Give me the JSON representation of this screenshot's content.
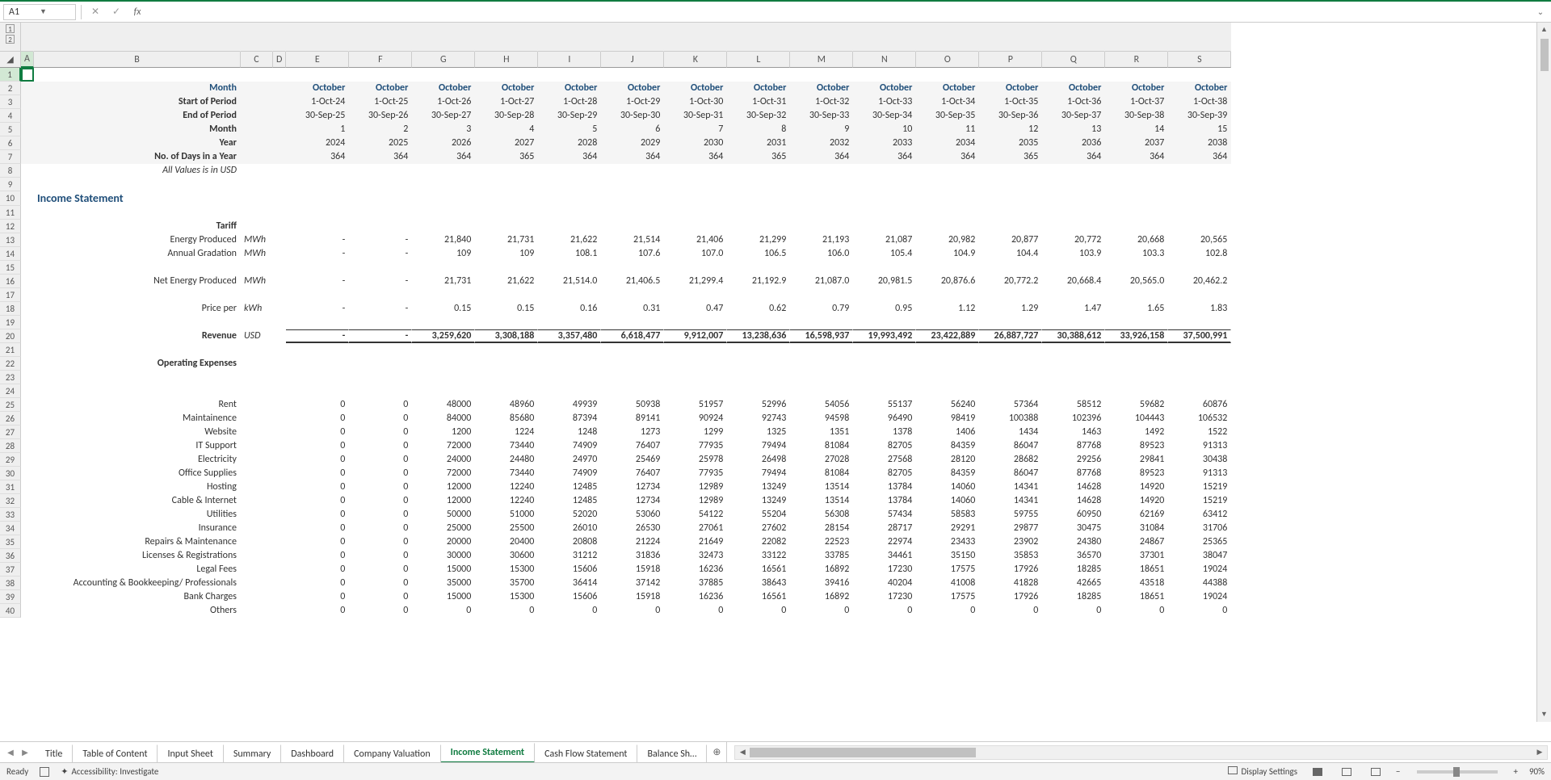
{
  "nameBox": "A1",
  "formula": "",
  "outlineLevels": [
    "1",
    "2"
  ],
  "colHeaders": [
    "",
    "A",
    "B",
    "C",
    "D",
    "E",
    "F",
    "G",
    "H",
    "I",
    "J",
    "K",
    "L",
    "M",
    "N",
    "O",
    "P",
    "Q",
    "R",
    "S"
  ],
  "rowHeaders": [
    "1",
    "2",
    "3",
    "4",
    "5",
    "6",
    "7",
    "8",
    "9",
    "10",
    "11",
    "12",
    "13",
    "14",
    "15",
    "16",
    "17",
    "18",
    "19",
    "20",
    "21",
    "22",
    "23",
    "24",
    "25",
    "26",
    "27",
    "28",
    "29",
    "30",
    "31",
    "32",
    "33",
    "34",
    "35",
    "36",
    "37",
    "38",
    "39",
    "40"
  ],
  "headerBlock": {
    "monthLabel": "Month",
    "startLabel": "Start of Period",
    "endLabel": "End of Period",
    "monthLabel2": "Month",
    "yearLabel": "Year",
    "daysLabel": "No. of Days in a Year",
    "noteLabel": "All Values is in USD",
    "monthRow": [
      "October",
      "October",
      "October",
      "October",
      "October",
      "October",
      "October",
      "October",
      "October",
      "October",
      "October",
      "October",
      "October",
      "October",
      "October"
    ],
    "startRow": [
      "1-Oct-24",
      "1-Oct-25",
      "1-Oct-26",
      "1-Oct-27",
      "1-Oct-28",
      "1-Oct-29",
      "1-Oct-30",
      "1-Oct-31",
      "1-Oct-32",
      "1-Oct-33",
      "1-Oct-34",
      "1-Oct-35",
      "1-Oct-36",
      "1-Oct-37",
      "1-Oct-38"
    ],
    "endRow": [
      "30-Sep-25",
      "30-Sep-26",
      "30-Sep-27",
      "30-Sep-28",
      "30-Sep-29",
      "30-Sep-30",
      "30-Sep-31",
      "30-Sep-32",
      "30-Sep-33",
      "30-Sep-34",
      "30-Sep-35",
      "30-Sep-36",
      "30-Sep-37",
      "30-Sep-38",
      "30-Sep-39"
    ],
    "monthNumRow": [
      "1",
      "2",
      "3",
      "4",
      "5",
      "6",
      "7",
      "8",
      "9",
      "10",
      "11",
      "12",
      "13",
      "14",
      "15"
    ],
    "yearRow": [
      "2024",
      "2025",
      "2026",
      "2027",
      "2028",
      "2029",
      "2030",
      "2031",
      "2032",
      "2033",
      "2034",
      "2035",
      "2036",
      "2037",
      "2038"
    ],
    "daysRow": [
      "364",
      "364",
      "364",
      "365",
      "364",
      "364",
      "364",
      "365",
      "364",
      "364",
      "364",
      "365",
      "364",
      "364",
      "364"
    ]
  },
  "sectionIncome": "Income Statement",
  "sectionTariff": "Tariff",
  "tariff": {
    "energyProducedLabel": "Energy Produced",
    "energyProducedUnit": "MWh",
    "energyProduced": [
      "-",
      "-",
      "21,840",
      "21,731",
      "21,622",
      "21,514",
      "21,406",
      "21,299",
      "21,193",
      "21,087",
      "20,982",
      "20,877",
      "20,772",
      "20,668",
      "20,565"
    ],
    "gradationLabel": "Annual Gradation",
    "gradationUnit": "MWh",
    "gradation": [
      "-",
      "-",
      "109",
      "109",
      "108.1",
      "107.6",
      "107.0",
      "106.5",
      "106.0",
      "105.4",
      "104.9",
      "104.4",
      "103.9",
      "103.3",
      "102.8"
    ],
    "netEnergyLabel": "Net Energy Produced",
    "netEnergyUnit": "MWh",
    "netEnergy": [
      "-",
      "-",
      "21,731",
      "21,622",
      "21,514.0",
      "21,406.5",
      "21,299.4",
      "21,192.9",
      "21,087.0",
      "20,981.5",
      "20,876.6",
      "20,772.2",
      "20,668.4",
      "20,565.0",
      "20,462.2"
    ],
    "priceLabel": "Price per",
    "priceUnit": "kWh",
    "price": [
      "-",
      "-",
      "0.15",
      "0.15",
      "0.16",
      "0.31",
      "0.47",
      "0.62",
      "0.79",
      "0.95",
      "1.12",
      "1.29",
      "1.47",
      "1.65",
      "1.83"
    ]
  },
  "revenueLabel": "Revenue",
  "revenueUnit": "USD",
  "revenue": [
    "-",
    "-",
    "3,259,620",
    "3,308,188",
    "3,357,480",
    "6,618,477",
    "9,912,007",
    "13,238,636",
    "16,598,937",
    "19,993,492",
    "23,422,889",
    "26,887,727",
    "30,388,612",
    "33,926,158",
    "37,500,991"
  ],
  "sectionOpex": "Operating Expenses",
  "opexRows": [
    {
      "label": "Rent",
      "v": [
        "0",
        "0",
        "48000",
        "48960",
        "49939",
        "50938",
        "51957",
        "52996",
        "54056",
        "55137",
        "56240",
        "57364",
        "58512",
        "59682",
        "60876"
      ]
    },
    {
      "label": "Maintainence",
      "v": [
        "0",
        "0",
        "84000",
        "85680",
        "87394",
        "89141",
        "90924",
        "92743",
        "94598",
        "96490",
        "98419",
        "100388",
        "102396",
        "104443",
        "106532"
      ]
    },
    {
      "label": "Website",
      "v": [
        "0",
        "0",
        "1200",
        "1224",
        "1248",
        "1273",
        "1299",
        "1325",
        "1351",
        "1378",
        "1406",
        "1434",
        "1463",
        "1492",
        "1522"
      ]
    },
    {
      "label": "IT Support",
      "v": [
        "0",
        "0",
        "72000",
        "73440",
        "74909",
        "76407",
        "77935",
        "79494",
        "81084",
        "82705",
        "84359",
        "86047",
        "87768",
        "89523",
        "91313"
      ]
    },
    {
      "label": "Electricity",
      "v": [
        "0",
        "0",
        "24000",
        "24480",
        "24970",
        "25469",
        "25978",
        "26498",
        "27028",
        "27568",
        "28120",
        "28682",
        "29256",
        "29841",
        "30438"
      ]
    },
    {
      "label": "Office Supplies",
      "v": [
        "0",
        "0",
        "72000",
        "73440",
        "74909",
        "76407",
        "77935",
        "79494",
        "81084",
        "82705",
        "84359",
        "86047",
        "87768",
        "89523",
        "91313"
      ]
    },
    {
      "label": "Hosting",
      "v": [
        "0",
        "0",
        "12000",
        "12240",
        "12485",
        "12734",
        "12989",
        "13249",
        "13514",
        "13784",
        "14060",
        "14341",
        "14628",
        "14920",
        "15219"
      ]
    },
    {
      "label": "Cable & Internet",
      "v": [
        "0",
        "0",
        "12000",
        "12240",
        "12485",
        "12734",
        "12989",
        "13249",
        "13514",
        "13784",
        "14060",
        "14341",
        "14628",
        "14920",
        "15219"
      ]
    },
    {
      "label": "Utilities",
      "v": [
        "0",
        "0",
        "50000",
        "51000",
        "52020",
        "53060",
        "54122",
        "55204",
        "56308",
        "57434",
        "58583",
        "59755",
        "60950",
        "62169",
        "63412"
      ]
    },
    {
      "label": "Insurance",
      "v": [
        "0",
        "0",
        "25000",
        "25500",
        "26010",
        "26530",
        "27061",
        "27602",
        "28154",
        "28717",
        "29291",
        "29877",
        "30475",
        "31084",
        "31706"
      ]
    },
    {
      "label": "Repairs & Maintenance",
      "v": [
        "0",
        "0",
        "20000",
        "20400",
        "20808",
        "21224",
        "21649",
        "22082",
        "22523",
        "22974",
        "23433",
        "23902",
        "24380",
        "24867",
        "25365"
      ]
    },
    {
      "label": "Licenses & Registrations",
      "v": [
        "0",
        "0",
        "30000",
        "30600",
        "31212",
        "31836",
        "32473",
        "33122",
        "33785",
        "34461",
        "35150",
        "35853",
        "36570",
        "37301",
        "38047"
      ]
    },
    {
      "label": "Legal Fees",
      "v": [
        "0",
        "0",
        "15000",
        "15300",
        "15606",
        "15918",
        "16236",
        "16561",
        "16892",
        "17230",
        "17575",
        "17926",
        "18285",
        "18651",
        "19024"
      ]
    },
    {
      "label": "Accounting & Bookkeeping/ Professionals",
      "v": [
        "0",
        "0",
        "35000",
        "35700",
        "36414",
        "37142",
        "37885",
        "38643",
        "39416",
        "40204",
        "41008",
        "41828",
        "42665",
        "43518",
        "44388"
      ]
    },
    {
      "label": "Bank Charges",
      "v": [
        "0",
        "0",
        "15000",
        "15300",
        "15606",
        "15918",
        "16236",
        "16561",
        "16892",
        "17230",
        "17575",
        "17926",
        "18285",
        "18651",
        "19024"
      ]
    },
    {
      "label": "Others",
      "v": [
        "0",
        "0",
        "0",
        "0",
        "0",
        "0",
        "0",
        "0",
        "0",
        "0",
        "0",
        "0",
        "0",
        "0",
        "0"
      ]
    }
  ],
  "tabs": [
    "Title",
    "Table of Content",
    "Input Sheet",
    "Summary",
    "Dashboard",
    "Company Valuation",
    "Income Statement",
    "Cash Flow Statement",
    "Balance Sh…"
  ],
  "activeTab": 6,
  "statusBar": {
    "ready": "Ready",
    "accessibility": "Accessibility: Investigate",
    "displaySettings": "Display Settings",
    "zoom": "90%"
  }
}
